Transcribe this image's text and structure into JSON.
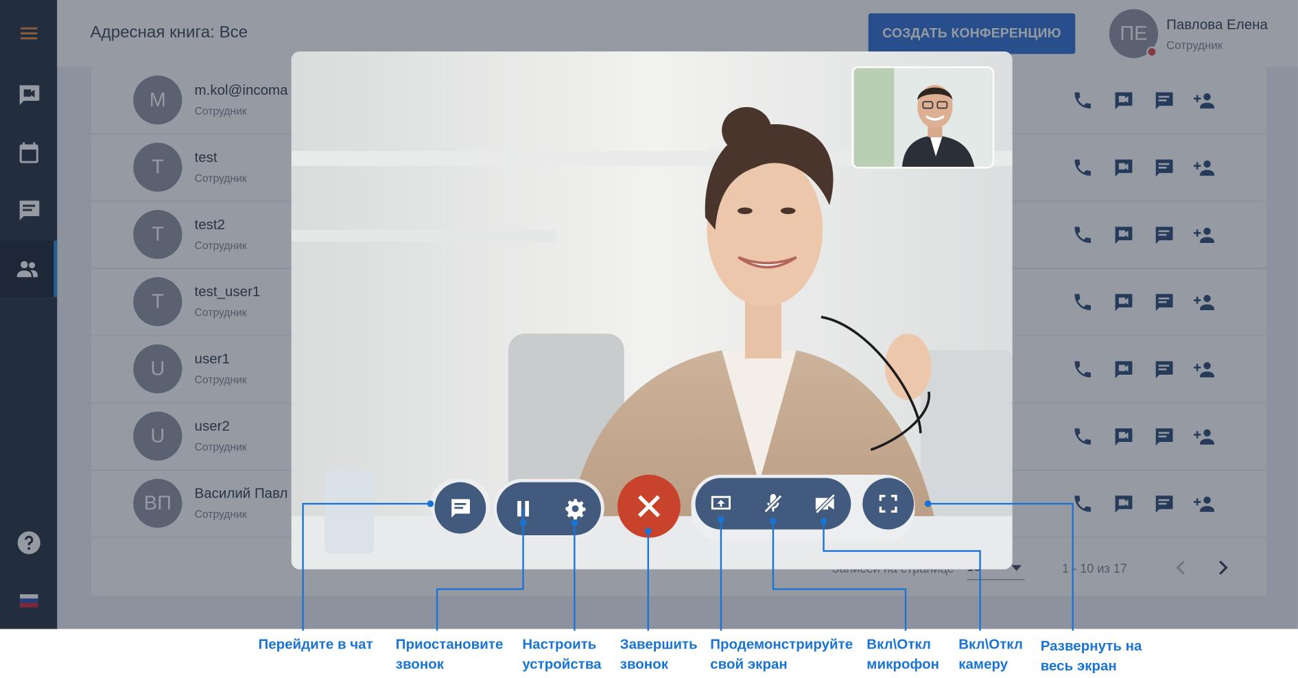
{
  "sidebar": {
    "items": [
      {
        "icon": "menu-icon"
      },
      {
        "icon": "video-icon"
      },
      {
        "icon": "calendar-icon"
      },
      {
        "icon": "chat-icon"
      },
      {
        "icon": "contacts-icon",
        "active": true
      },
      {
        "icon": "help-icon"
      },
      {
        "icon": "language-flag-icon"
      }
    ]
  },
  "header": {
    "title": "Адресная книга: Все",
    "create_button": "СОЗДАТЬ КОНФЕРЕНЦИЮ",
    "user": {
      "initials": "ПЕ",
      "name": "Павлова Елена",
      "role": "Сотрудник",
      "status_color": "#e04646"
    }
  },
  "contacts": [
    {
      "initials": "M",
      "name": "m.kol@incomа",
      "role": "Сотрудник"
    },
    {
      "initials": "T",
      "name": "test",
      "role": "Сотрудник"
    },
    {
      "initials": "T",
      "name": "test2",
      "role": "Сотрудник"
    },
    {
      "initials": "T",
      "name": "test_user1",
      "role": "Сотрудник"
    },
    {
      "initials": "U",
      "name": "user1",
      "role": "Сотрудник"
    },
    {
      "initials": "U",
      "name": "user2",
      "role": "Сотрудник"
    },
    {
      "initials": "ВП",
      "name": "Василий Павл",
      "role": "Сотрудник"
    }
  ],
  "row_actions": [
    "phone-icon",
    "video-call-icon",
    "message-icon",
    "add-contact-icon"
  ],
  "pagination": {
    "rows_label": "Записей на странице",
    "rows_value": "10",
    "range": "1 - 10 из 17"
  },
  "call_controls": [
    "chat",
    "pause",
    "settings",
    "end-call",
    "share-screen",
    "mic-toggle",
    "camera-toggle",
    "fullscreen"
  ],
  "captions": {
    "chat": [
      "Перейдите в чат"
    ],
    "pause": [
      "Приостановите",
      "звонок"
    ],
    "settings": [
      "Настроить",
      "устройства"
    ],
    "end": [
      "Завершить",
      "звонок"
    ],
    "share": [
      "Продемонстрируйте",
      "свой экран"
    ],
    "mic": [
      "Вкл\\Откл",
      "микрофон"
    ],
    "camera": [
      "Вкл\\Откл",
      "камеру"
    ],
    "fullscreen": [
      "Развернуть на",
      "весь экран"
    ]
  },
  "colors": {
    "sidebar": "#242f3e",
    "primary_button": "#2f6fd2",
    "control": "#415a7d",
    "end_call": "#c8422c",
    "callout": "#1a74d4",
    "action_icons": "#2a4a72"
  }
}
